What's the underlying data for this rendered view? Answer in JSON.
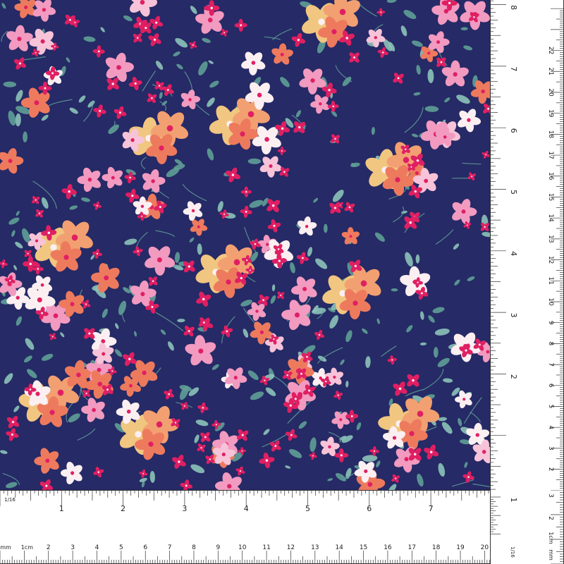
{
  "swatch": {
    "background_color": "#262a66",
    "palette": {
      "leaf": "#5f9e96",
      "leaf_light": "#8cc2b8",
      "magenta": "#e01f63",
      "pink": "#f29ac0",
      "light_pink": "#f7c3d8",
      "coral": "#ee7a5e",
      "peach": "#f2a071",
      "yellow": "#f1c680",
      "white": "#fbeff2"
    }
  },
  "ruler_bottom": {
    "inch_caption": "1/16",
    "inch_labels": [
      "1",
      "2",
      "3",
      "4",
      "5",
      "6",
      "7"
    ],
    "mm_caption": "mm",
    "cm_caption": "1cm",
    "cm_labels": [
      "2",
      "3",
      "4",
      "5",
      "6",
      "7",
      "8",
      "9",
      "10",
      "11",
      "12",
      "13",
      "14",
      "15",
      "16",
      "17",
      "18",
      "19",
      "20"
    ]
  },
  "ruler_right": {
    "inch_labels": [
      "8",
      "7",
      "6",
      "5",
      "4",
      "3",
      "2"
    ],
    "cm_labels": [
      "22",
      "21",
      "20",
      "19",
      "18",
      "17",
      "16",
      "15",
      "14",
      "13",
      "12",
      "11",
      "10",
      "9",
      "8",
      "7",
      "6",
      "5",
      "4",
      "3",
      "2"
    ]
  },
  "ruler_corner": {
    "inch_labels": [
      "1"
    ],
    "cm_labels": [
      "3",
      "2"
    ],
    "cm_caption": "1cm",
    "mm_caption": "mm",
    "inch_caption": "1/16"
  }
}
